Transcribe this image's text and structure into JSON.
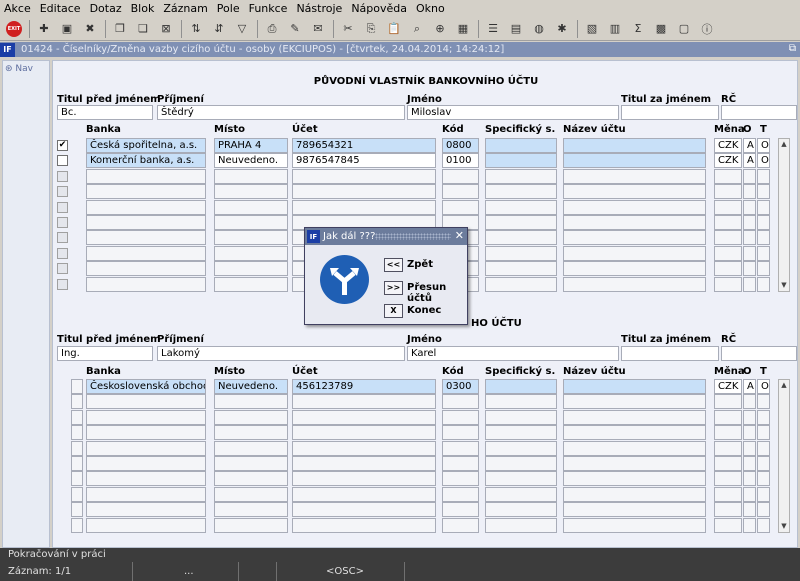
{
  "menu": [
    "Akce",
    "Editace",
    "Dotaz",
    "Blok",
    "Záznam",
    "Pole",
    "Funkce",
    "Nástroje",
    "Nápověda",
    "Okno"
  ],
  "toolbar": {
    "exit_label": "EXIT"
  },
  "window": {
    "logo": "IF",
    "title": "01424 - Číselníky/Změna vazby cizího účtu - osoby (EKCIUPOS) - [čtvrtek, 24.04.2014; 14:24:12]",
    "restore_icon": "⧉"
  },
  "nav": {
    "label": "Nav"
  },
  "original": {
    "section_title": "PŮVODNÍ VLASTNÍK BANKOVNÍHO ÚČTU",
    "labels": {
      "title_before": "Titul před jménem",
      "surname": "Příjmení",
      "name": "Jméno",
      "title_after": "Titul za jménem",
      "rc": "RČ"
    },
    "values": {
      "title_before": "Bc.",
      "surname": "Štědrý",
      "name": "Miloslav",
      "title_after": "",
      "rc": ""
    },
    "columns": [
      "Banka",
      "Místo",
      "Účet",
      "Kód",
      "Specifický s.",
      "Název účtu",
      "Měna",
      "O",
      "T"
    ],
    "rows": [
      {
        "checked": "✔",
        "bank": "Česká spořitelna, a.s.",
        "place": "PRAHA 4",
        "account": "789654321",
        "code": "0800",
        "spec": "",
        "name": "",
        "currency": "CZK",
        "o": "A",
        "t": "O"
      },
      {
        "checked": "",
        "bank": "Komerční banka, a.s.",
        "place": "Neuvedeno.",
        "account": "9876547845",
        "code": "0100",
        "spec": "",
        "name": "",
        "currency": "CZK",
        "o": "A",
        "t": "O"
      }
    ]
  },
  "new_owner": {
    "section_title_visible": "HO ÚČTU",
    "labels": {
      "title_before": "Titul před jménem",
      "surname": "Příjmení",
      "name": "Jméno",
      "title_after": "Titul za jménem",
      "rc": "RČ"
    },
    "values": {
      "title_before": "Ing.",
      "surname": "Lakomý",
      "name": "Karel",
      "title_after": "",
      "rc": ""
    },
    "columns": [
      "Banka",
      "Místo",
      "Účet",
      "Kód",
      "Specifický s.",
      "Název účtu",
      "Měna",
      "O",
      "T"
    ],
    "rows": [
      {
        "bank": "Československá obchodní bank",
        "place": "Neuvedeno.",
        "account": "456123789",
        "code": "0300",
        "spec": "",
        "name": "",
        "currency": "CZK",
        "o": "A",
        "t": "O"
      }
    ]
  },
  "dialog": {
    "logo": "IF",
    "title": "Jak dál ???",
    "close_icon": "✕",
    "buttons": [
      {
        "key": "<<",
        "label": "Zpět"
      },
      {
        "key": ">>",
        "label": "Přesun účtů"
      },
      {
        "key": "X",
        "label": "Konec"
      }
    ]
  },
  "status": {
    "message": "Pokračování v práci",
    "record": "Záznam: 1/1",
    "field1": "...",
    "field2": "<OSC>"
  }
}
